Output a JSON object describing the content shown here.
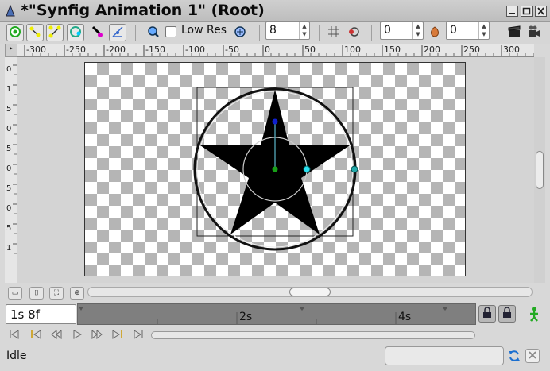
{
  "window": {
    "title": "*\"Synfig Animation 1\" (Root)"
  },
  "toolbar": {
    "lowres_label": "Low Res",
    "lowres_checked": false,
    "quality_value": "8",
    "onion_past_value": "0",
    "onion_future_value": "0"
  },
  "ruler": {
    "top_labels": [
      "-300",
      "-250",
      "-200",
      "-150",
      "-100",
      "-50",
      "0",
      "50",
      "100",
      "150",
      "200",
      "250",
      "300"
    ],
    "left_labels": [
      "0",
      "1",
      "5",
      "0",
      "5",
      "0",
      "5",
      "0",
      "5",
      "1"
    ]
  },
  "timebar": {
    "current_time": "1s 8f",
    "labels": [
      "2s",
      "4s"
    ]
  },
  "status": {
    "text": "Idle"
  },
  "colors": {
    "checker_dark": "#b5b5b5",
    "checker_light": "#ffffff",
    "timebar": "#7f7f7f",
    "time_cursor": "#d9a400"
  },
  "icons": {
    "app": "synfig-logo-icon",
    "transform": "transform-tool-icon",
    "smooth_move": "smooth-move-icon",
    "scale": "scale-tool-icon",
    "rotate": "rotate-tool-icon",
    "mirror": "mirror-tool-icon",
    "draw": "draw-tool-icon",
    "render": "render-icon",
    "preview": "preview-icon",
    "grid": "grid-icon",
    "onion": "onion-skin-icon",
    "lock": "lock-icon",
    "refresh": "refresh-icon",
    "person": "animation-mode-icon"
  }
}
